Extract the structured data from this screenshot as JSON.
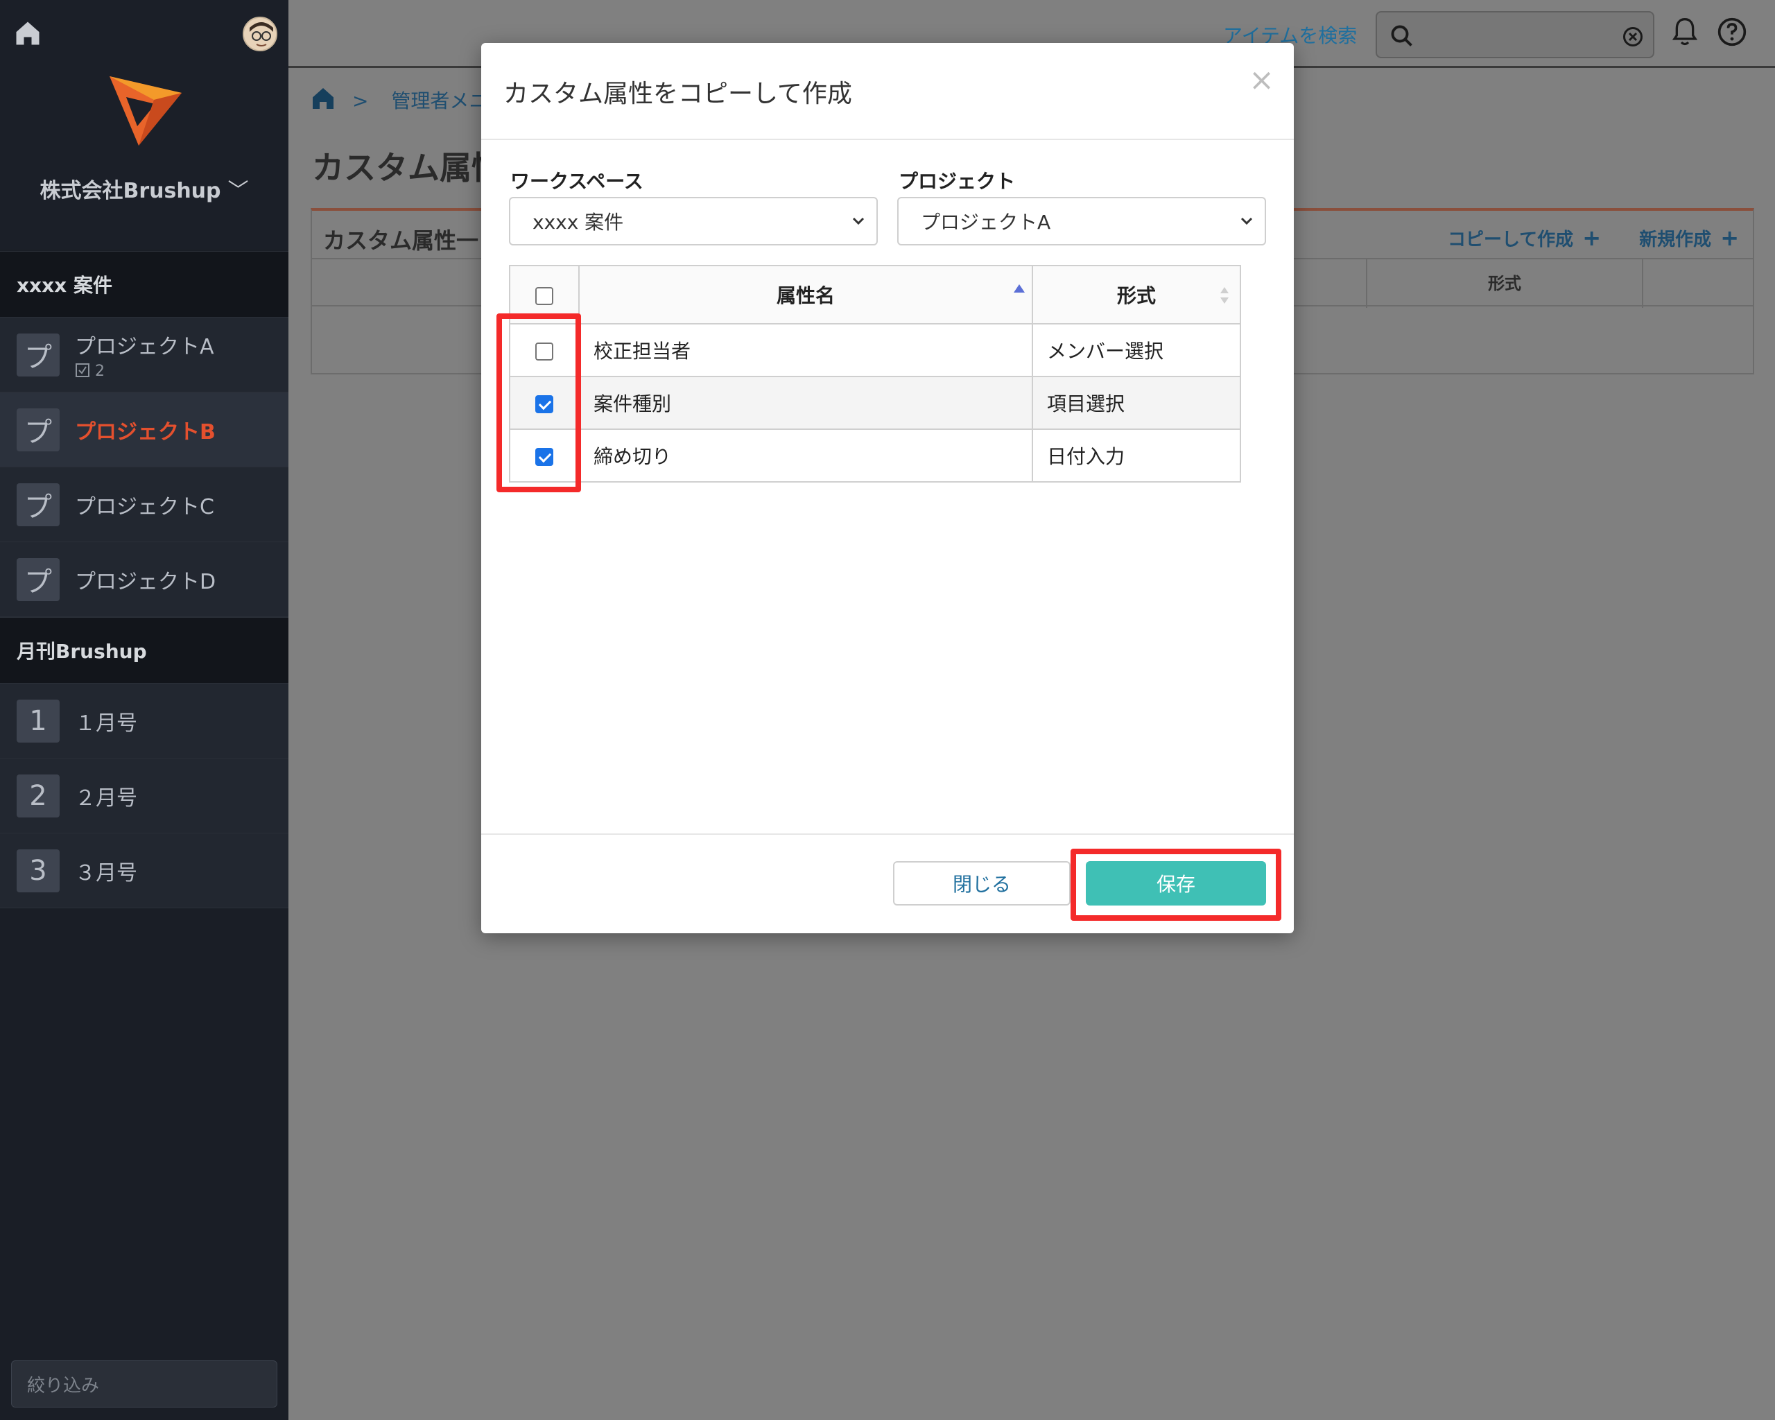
{
  "sidebar": {
    "company": "株式会社Brushup",
    "company_chevron": "﹀",
    "workspaces": [
      {
        "name": "xxxx 案件",
        "items": [
          {
            "badge": "プ",
            "label": "プロジェクトA",
            "sub": "2",
            "active": false
          },
          {
            "badge": "プ",
            "label": "プロジェクトB",
            "active": true
          },
          {
            "badge": "プ",
            "label": "プロジェクトC",
            "active": false
          },
          {
            "badge": "プ",
            "label": "プロジェクトD",
            "active": false
          }
        ]
      },
      {
        "name": "月刊Brushup",
        "items": [
          {
            "badge": "1",
            "label": "１月号"
          },
          {
            "badge": "2",
            "label": "２月号"
          },
          {
            "badge": "3",
            "label": "３月号"
          }
        ]
      }
    ],
    "filter_placeholder": "絞り込み"
  },
  "topbar": {
    "search_link": "アイテムを検索",
    "icons": [
      "search-icon",
      "clear-icon",
      "bell-icon",
      "help-icon"
    ]
  },
  "breadcrumb": {
    "separator": ">",
    "current": "管理者メニュ"
  },
  "page": {
    "title": "カスタム属性",
    "panel_title": "カスタム属性一",
    "copy_create": "コピーして作成",
    "new_create": "新規作成",
    "plus": "+",
    "col_format": "形式"
  },
  "modal": {
    "title": "カスタム属性をコピーして作成",
    "close_glyph": "×",
    "workspace_label": "ワークスペース",
    "workspace_value": "xxxx 案件",
    "project_label": "プロジェクト",
    "project_value": "プロジェクトA",
    "table": {
      "col_name": "属性名",
      "col_format": "形式",
      "rows": [
        {
          "name": "校正担当者",
          "format": "メンバー選択",
          "checked": false
        },
        {
          "name": "案件種別",
          "format": "項目選択",
          "checked": true
        },
        {
          "name": "締め切り",
          "format": "日付入力",
          "checked": true
        }
      ]
    },
    "btn_close": "閉じる",
    "btn_save": "保存"
  },
  "colors": {
    "accent_teal": "#3fc0b5",
    "highlight_red": "#f42a2a",
    "active_project": "#e4502e",
    "sidebar_bg": "#1a1e26",
    "overlay": "#808080"
  }
}
